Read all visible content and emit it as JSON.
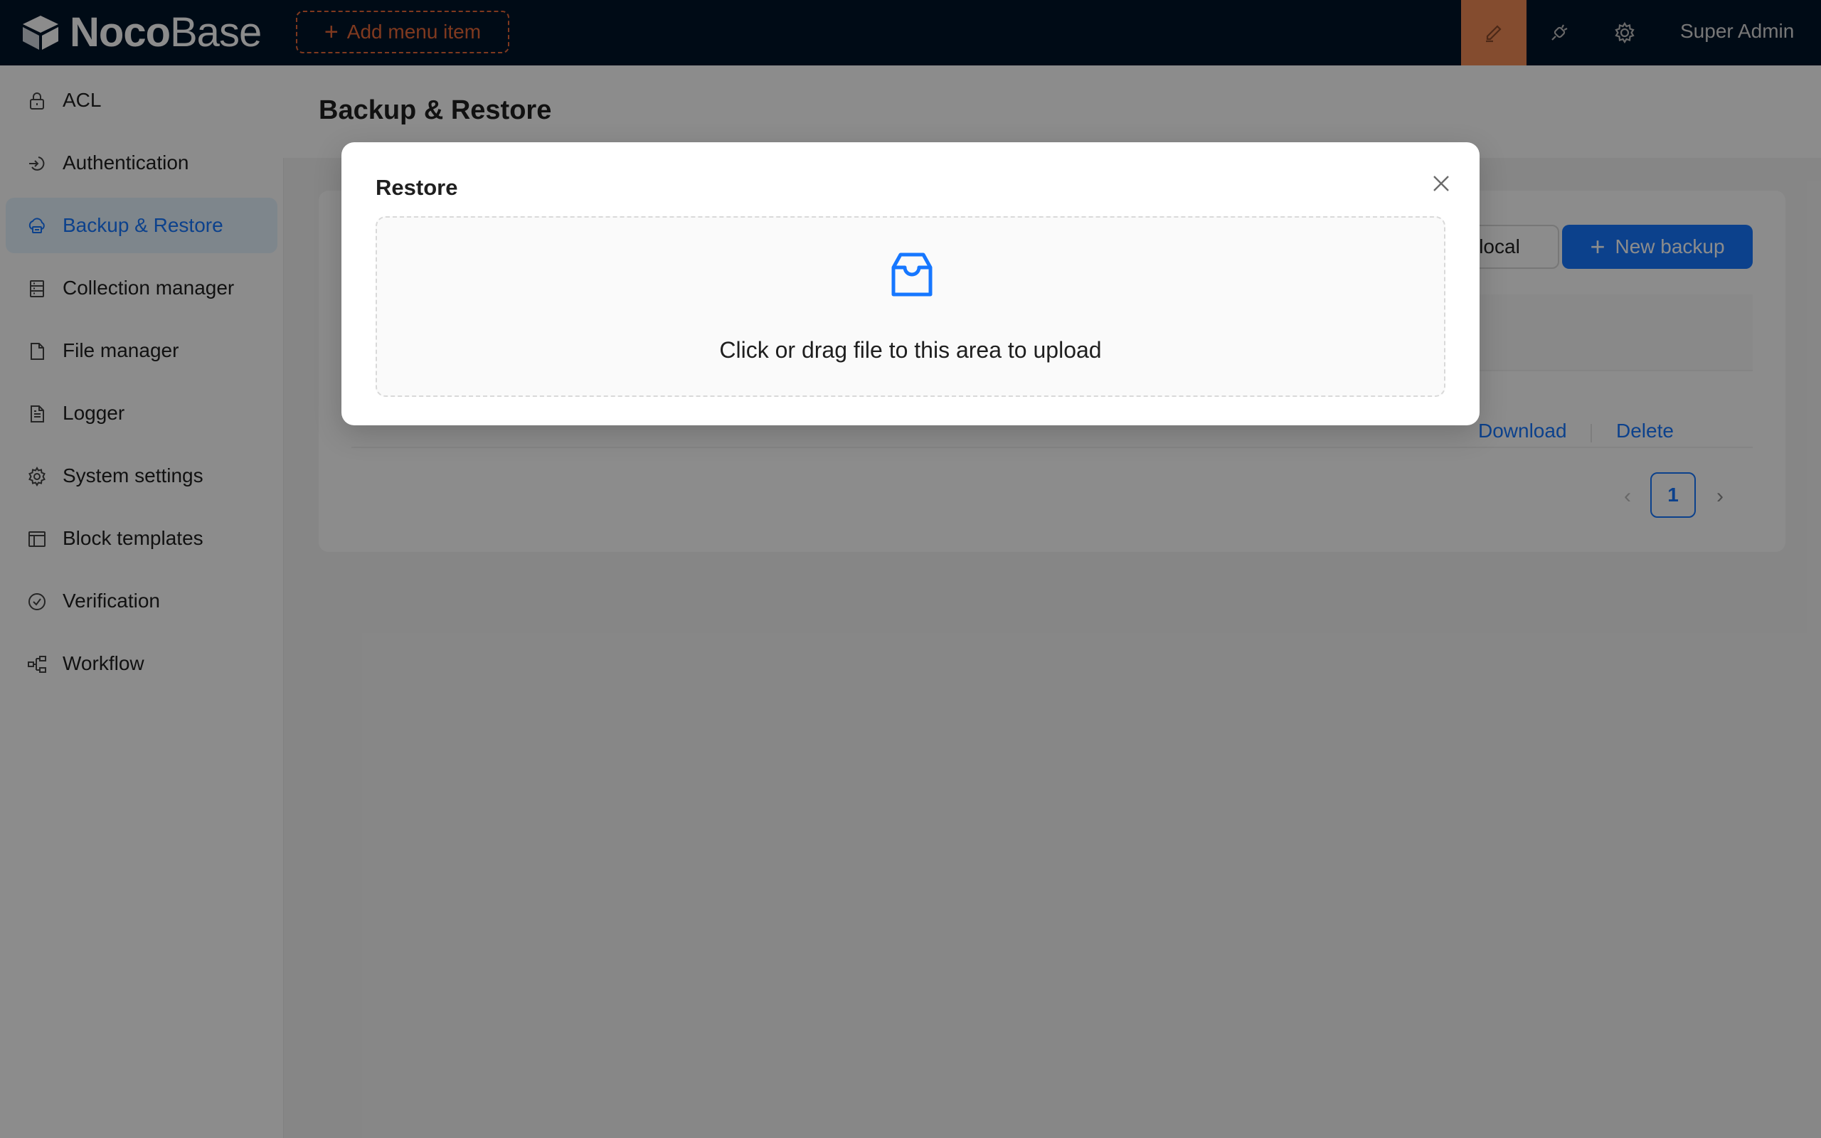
{
  "app": {
    "logo_text_bold": "Noco",
    "logo_text_light": "Base",
    "add_menu_label": "Add menu item",
    "user_name": "Super Admin",
    "colors": {
      "topbar": "#001529",
      "accent_orange": "#e8693a",
      "primary": "#1677ff"
    }
  },
  "toolbar": {
    "icons": [
      "highlighter-icon",
      "plugin-icon",
      "gear-icon"
    ]
  },
  "sidebar": {
    "items": [
      {
        "label": "ACL",
        "icon": "lock-icon"
      },
      {
        "label": "Authentication",
        "icon": "login-icon"
      },
      {
        "label": "Backup & Restore",
        "icon": "cloud-server-icon",
        "selected": true
      },
      {
        "label": "Collection manager",
        "icon": "database-icon"
      },
      {
        "label": "File manager",
        "icon": "file-icon"
      },
      {
        "label": "Logger",
        "icon": "file-text-icon"
      },
      {
        "label": "System settings",
        "icon": "gear-icon"
      },
      {
        "label": "Block templates",
        "icon": "layout-icon"
      },
      {
        "label": "Verification",
        "icon": "check-circle-icon"
      },
      {
        "label": "Workflow",
        "icon": "partition-icon"
      }
    ]
  },
  "page": {
    "title": "Backup & Restore",
    "local_button": "local",
    "new_backup_button": "New backup",
    "row_actions": {
      "download": "Download",
      "delete": "Delete"
    },
    "pagination": {
      "prev": "‹",
      "current": "1",
      "next": "›"
    }
  },
  "modal": {
    "title": "Restore",
    "dropzone_text": "Click or drag file to this area to upload"
  }
}
